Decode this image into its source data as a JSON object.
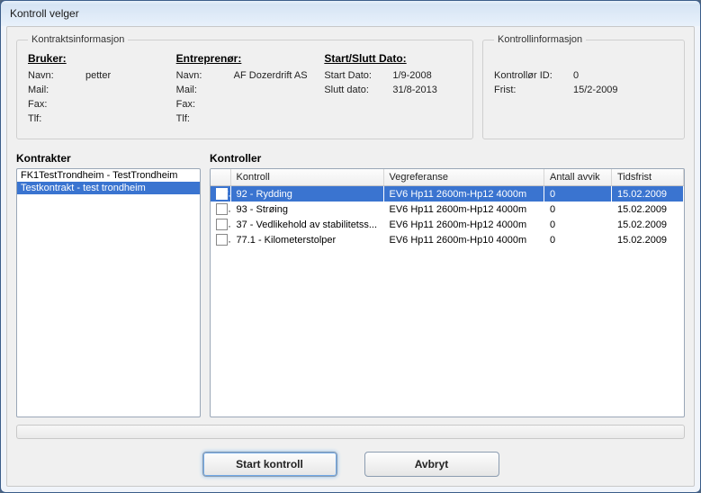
{
  "window": {
    "title": "Kontroll velger"
  },
  "contract_info": {
    "legend": "Kontraktsinformasjon",
    "user": {
      "heading": "Bruker:",
      "name_label": "Navn:",
      "name_value": "petter",
      "mail_label": "Mail:",
      "mail_value": "",
      "fax_label": "Fax:",
      "fax_value": "",
      "tlf_label": "Tlf:",
      "tlf_value": ""
    },
    "contractor": {
      "heading": "Entreprenør:",
      "name_label": "Navn:",
      "name_value": "AF Dozerdrift AS",
      "mail_label": "Mail:",
      "mail_value": "",
      "fax_label": "Fax:",
      "fax_value": "",
      "tlf_label": "Tlf:",
      "tlf_value": ""
    },
    "dates": {
      "heading": "Start/Slutt Dato:",
      "start_label": "Start Dato:",
      "start_value": "1/9-2008",
      "end_label": "Slutt dato:",
      "end_value": "31/8-2013"
    }
  },
  "control_info": {
    "legend": "Kontrollinformasjon",
    "id_label": "Kontrollør ID:",
    "id_value": "0",
    "deadline_label": "Frist:",
    "deadline_value": "15/2-2009"
  },
  "contracts": {
    "heading": "Kontrakter",
    "items": [
      {
        "label": "FK1TestTrondheim - TestTrondheim",
        "selected": false
      },
      {
        "label": "Testkontrakt - test trondheim",
        "selected": true
      }
    ]
  },
  "controls": {
    "heading": "Kontroller",
    "columns": {
      "kontroll": "Kontroll",
      "vegreferanse": "Vegreferanse",
      "avvik": "Antall avvik",
      "tidsfrist": "Tidsfrist"
    },
    "rows": [
      {
        "checked": true,
        "selected": true,
        "kontroll": "92 - Rydding",
        "vegreferanse": "EV6 Hp11 2600m-Hp12 4000m",
        "avvik": "0",
        "tidsfrist": "15.02.2009"
      },
      {
        "checked": false,
        "selected": false,
        "kontroll": "93 - Strøing",
        "vegreferanse": "EV6 Hp11 2600m-Hp12 4000m",
        "avvik": "0",
        "tidsfrist": "15.02.2009"
      },
      {
        "checked": false,
        "selected": false,
        "kontroll": "37 - Vedlikehold av stabilitetss...",
        "vegreferanse": "EV6 Hp11 2600m-Hp12 4000m",
        "avvik": "0",
        "tidsfrist": "15.02.2009"
      },
      {
        "checked": false,
        "selected": false,
        "kontroll": "77.1 - Kilometerstolper",
        "vegreferanse": "EV6 Hp11 2600m-Hp10 4000m",
        "avvik": "0",
        "tidsfrist": "15.02.2009"
      }
    ]
  },
  "buttons": {
    "start": "Start kontroll",
    "cancel": "Avbryt"
  }
}
